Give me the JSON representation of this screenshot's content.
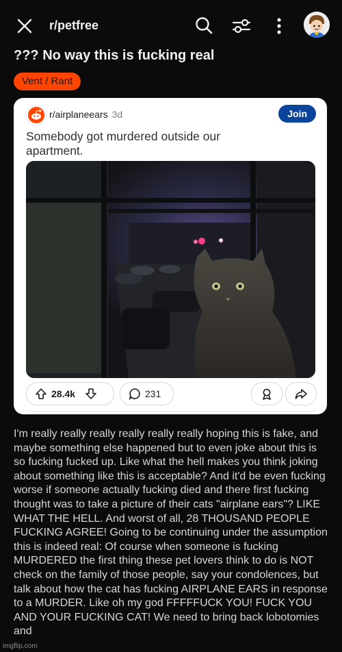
{
  "header": {
    "subreddit": "r/petfree",
    "close_icon": "close-icon",
    "search_icon": "search-icon",
    "filter_icon": "filter-icon",
    "more_icon": "more-vertical-icon"
  },
  "post": {
    "title": "??? No way this is fucking real",
    "flair": "Vent / Rant",
    "flair_color": "#ff4500"
  },
  "embedded": {
    "subreddit": "r/airplaneears",
    "age": "3d",
    "join_label": "Join",
    "join_color": "#0a449b",
    "title": "Somebody got murdered outside our apartment.",
    "upvotes": "28.4k",
    "comments": "231"
  },
  "body": "I'm really really really really really really hoping this is fake, and maybe something else happened but to even joke about this is so fucking fucked up. Like what the hell makes you think joking about something like this is acceptable? And it'd be even fucking worse if someone actually fucking died and there first fucking thought was to take a picture of their cats \"airplane ears\"? LIKE WHAT THE HELL. And worst of all, 28 THOUSAND PEOPLE FUCKING AGREE! Going to be continuing under the assumption this is indeed real: Of course when someone is fucking MURDERED the first thing these pet lovers think to do is NOT check on the family of those people, say your condolences, but talk about how the cat has fucking AIRPLANE EARS in response to a MURDER. Like oh my god FFFFFUCK YOU! FUCK YOU AND YOUR FUCKING CAT! We need to bring back lobotomies and",
  "watermark": "imgflip.com"
}
